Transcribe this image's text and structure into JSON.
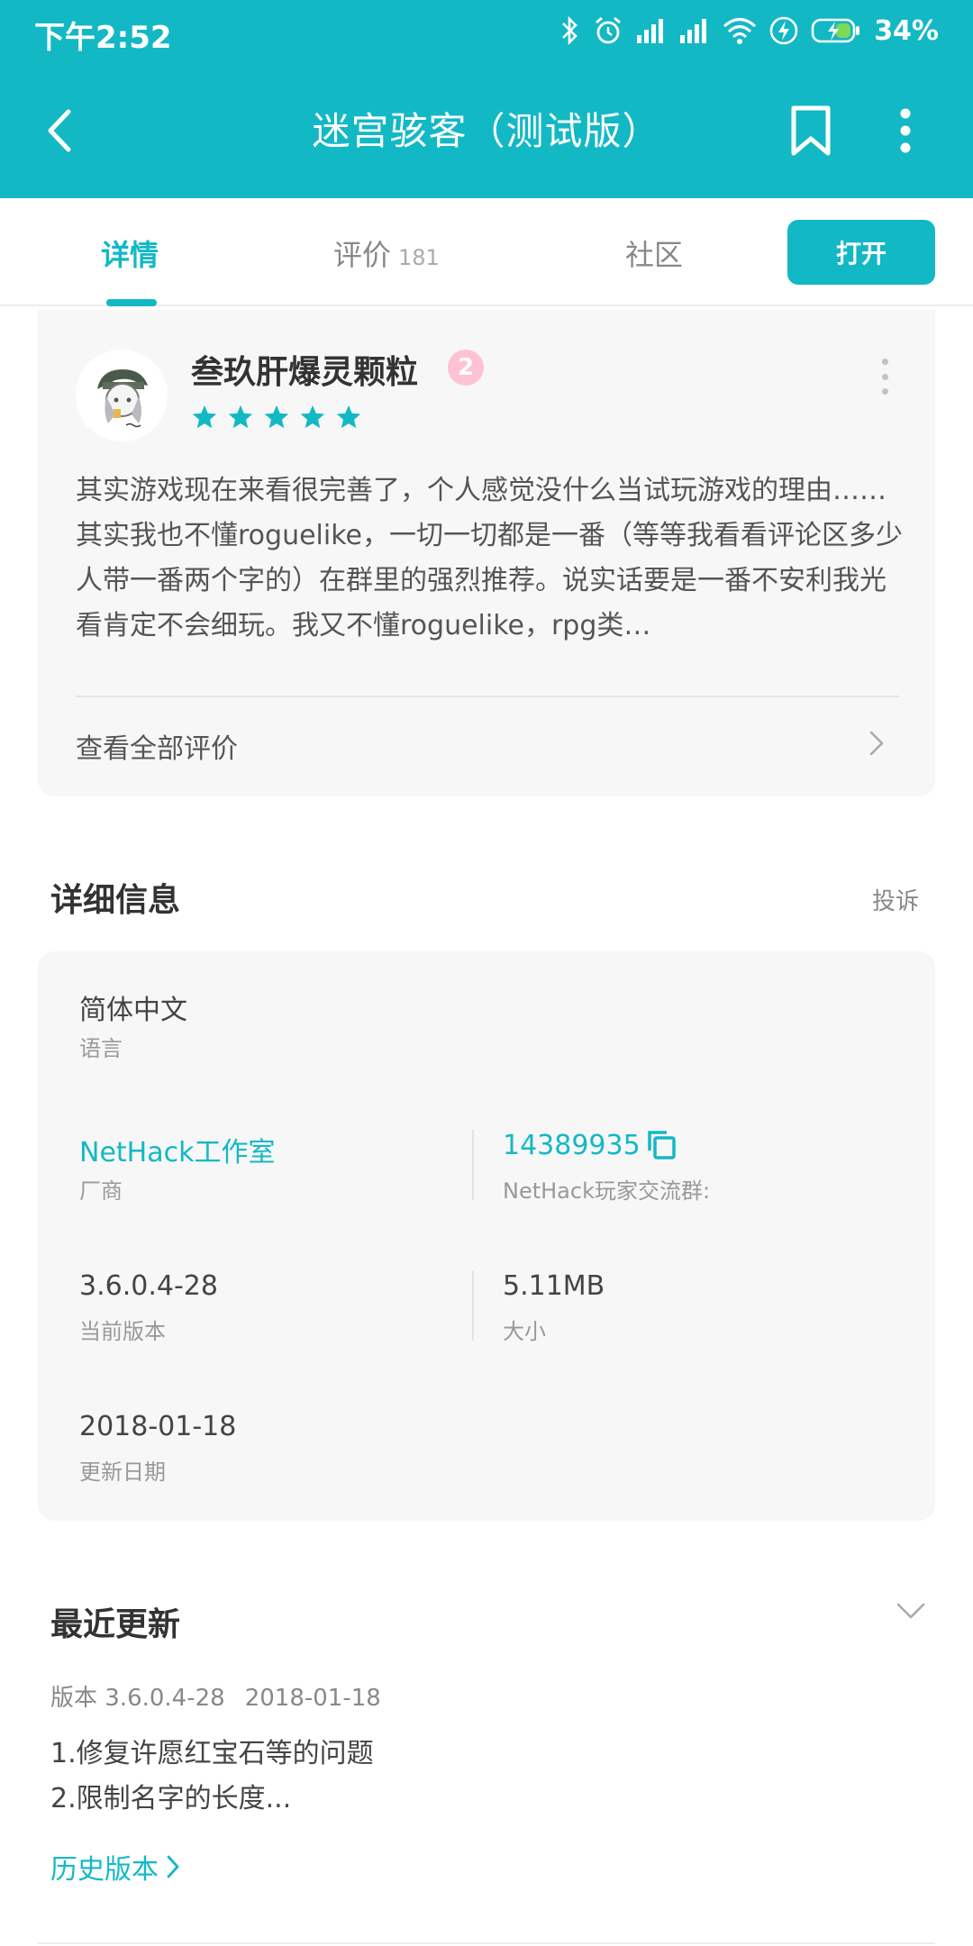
{
  "status_bar": {
    "time": "下午2:52",
    "battery": "34%"
  },
  "nav": {
    "title": "迷宫骇客（测试版）"
  },
  "tabs": [
    {
      "label": "详情",
      "active": true
    },
    {
      "label": "评价",
      "count": "181",
      "active": false
    },
    {
      "label": "社区",
      "active": false
    }
  ],
  "open_button": "打开",
  "review": {
    "reviewer_name": "叁玖肝爆灵颗粒",
    "level": "2",
    "rating": 5,
    "text": "其实游戏现在来看很完善了，个人感觉没什么当试玩游戏的理由……其实我也不懂roguelike，一切一切都是一番（等等我看看评论区多少人带一番两个字的）在群里的强烈推荐。说实话要是一番不安利我光看肯定不会细玩。我又不懂roguelike，rpg类…",
    "view_all": "查看全部评价"
  },
  "details": {
    "title": "详细信息",
    "report": "投诉",
    "language_value": "简体中文",
    "language_label": "语言",
    "vendor_value": "NetHack工作室",
    "vendor_label": "厂商",
    "group_value": "14389935",
    "group_label": "NetHack玩家交流群:",
    "version_value": "3.6.0.4-28",
    "version_label": "当前版本",
    "size_value": "5.11MB",
    "size_label": "大小",
    "date_value": "2018-01-18",
    "date_label": "更新日期"
  },
  "recent_update": {
    "title": "最近更新",
    "version": "版本 3.6.0.4-28",
    "date": "2018-01-18",
    "notes": [
      "1.修复许愿红宝石等的问题",
      "2.限制名字的长度..."
    ],
    "history_link": "历史版本"
  },
  "colors": {
    "accent": "#13b8c5",
    "card_bg": "#f7f7f7",
    "badge": "#ffc2d4"
  }
}
